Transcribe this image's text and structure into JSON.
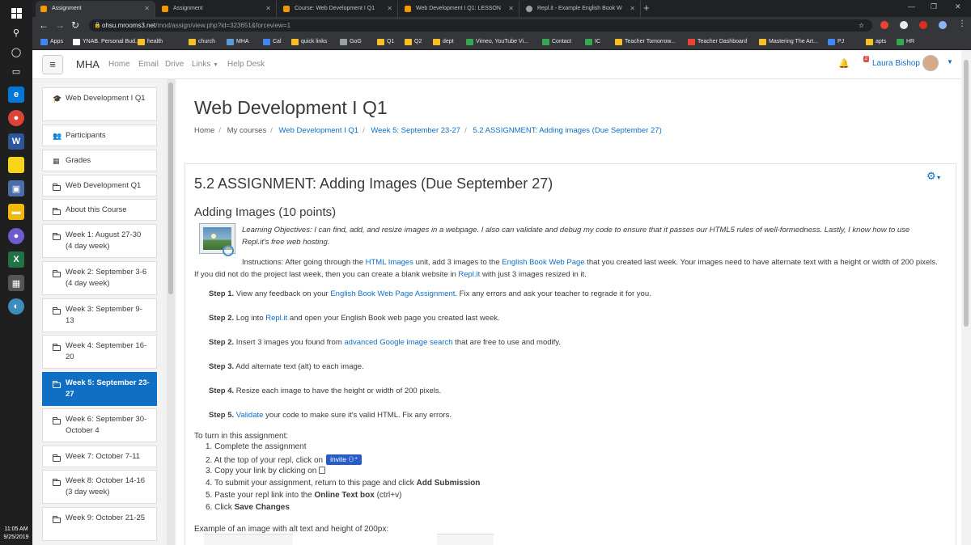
{
  "taskbar": {
    "clock_time": "11:05 AM",
    "clock_date": "9/25/2019"
  },
  "browser": {
    "tabs": [
      {
        "label": "Assignment",
        "active": true
      },
      {
        "label": "Assignment",
        "active": false
      },
      {
        "label": "Course: Web Development I Q1",
        "active": false
      },
      {
        "label": "Web Development I Q1: LESSON",
        "active": false
      },
      {
        "label": "Repl.it - Example English Book W",
        "active": false
      }
    ],
    "url_host": "ohsu.mrooms3.net",
    "url_path": "/mod/assign/view.php?id=323651&forceview=1",
    "bookmarks": [
      {
        "label": "Apps",
        "color": "#4285f4"
      },
      {
        "label": "YNAB. Personal Bud...",
        "color": "#ffffff"
      },
      {
        "label": "health",
        "color": "#f6c026"
      },
      {
        "label": "church",
        "color": "#f6c026"
      },
      {
        "label": "MHA",
        "color": "#5b9bd5"
      },
      {
        "label": "Cal",
        "color": "#4285f4"
      },
      {
        "label": "quick links",
        "color": "#f6c026"
      },
      {
        "label": "GoG",
        "color": "#9aa0a6"
      },
      {
        "label": "Q1",
        "color": "#f6c026"
      },
      {
        "label": "Q2",
        "color": "#f6c026"
      },
      {
        "label": "dept",
        "color": "#f6c026"
      },
      {
        "label": "Vimeo, YouTube Vi...",
        "color": "#34a853"
      },
      {
        "label": "Contact",
        "color": "#34a853"
      },
      {
        "label": "IC",
        "color": "#34a853"
      },
      {
        "label": "Teacher Tomorrow...",
        "color": "#f6c026"
      },
      {
        "label": "Teacher Dashboard",
        "color": "#ea4335"
      },
      {
        "label": "Mastering The Art...",
        "color": "#f6c026"
      },
      {
        "label": "PJ",
        "color": "#4285f4"
      },
      {
        "label": "apts",
        "color": "#f6c026"
      },
      {
        "label": "HR",
        "color": "#34a853"
      }
    ]
  },
  "navbar": {
    "brand": "MHA",
    "links": [
      "Home",
      "Email",
      "Drive",
      "Links",
      "Help Desk"
    ],
    "user_name": "Laura Bishop",
    "notification_count": "2"
  },
  "drawer": {
    "items": [
      {
        "label": "Web Development I Q1",
        "icon": "graduation-cap-icon",
        "active": false
      },
      {
        "label": "Participants",
        "icon": "users-icon",
        "active": false
      },
      {
        "label": "Grades",
        "icon": "table-icon",
        "active": false
      },
      {
        "label": "Web Development Q1",
        "icon": "folder-icon",
        "active": false
      },
      {
        "label": "About this Course",
        "icon": "folder-icon",
        "active": false
      },
      {
        "label": "Week 1: August 27-30 (4 day week)",
        "icon": "folder-icon",
        "active": false
      },
      {
        "label": "Week 2: September 3-6 (4 day week)",
        "icon": "folder-icon",
        "active": false
      },
      {
        "label": "Week 3: September 9-13",
        "icon": "folder-icon",
        "active": false
      },
      {
        "label": "Week 4: September 16-20",
        "icon": "folder-icon",
        "active": false
      },
      {
        "label": "Week 5: September 23-27",
        "icon": "folder-icon",
        "active": true
      },
      {
        "label": "Week 6: September 30-October 4",
        "icon": "folder-icon",
        "active": false
      },
      {
        "label": "Week 7: October 7-11",
        "icon": "folder-icon",
        "active": false
      },
      {
        "label": "Week 8: October 14-16 (3 day week)",
        "icon": "folder-icon",
        "active": false
      },
      {
        "label": "Week 9: October 21-25",
        "icon": "folder-icon",
        "active": false
      }
    ]
  },
  "main": {
    "course_title": "Web Development I Q1",
    "breadcrumb": [
      {
        "label": "Home",
        "link": false
      },
      {
        "label": "My courses",
        "link": false
      },
      {
        "label": "Web Development I Q1",
        "link": true
      },
      {
        "label": "Week 5: September 23-27",
        "link": true
      },
      {
        "label": "5.2 ASSIGNMENT: Adding images (Due September 27)",
        "link": true
      }
    ],
    "assignment_title": "5.2 ASSIGNMENT: Adding Images (Due September 27)",
    "section_title": "Adding Images (10 points)",
    "objectives": "Learning Objectives: I can find, add, and resize images in a webpage. I also can validate and debug my code to ensure that it passes our HTML5 rules of well-formedness. Lastly, I know how to use Repl.it's free web hosting.",
    "instructions": {
      "part1": "Instructions: After going through the ",
      "link1": "HTML Images",
      "part2": " unit, add 3 images to the ",
      "link2": "English Book Web Page",
      "part3": " that you created last week. Your images need to have alternate text with a height or width of 200 pixels. If you did not do the project last week, then you can create a blank website in ",
      "link3": "Repl.it",
      "part4": " with just 3 images resized in it."
    },
    "steps": [
      {
        "num": "Step 1.",
        "pre": " View any feedback on your ",
        "link": "English Book Web Page Assignment",
        "post": ". Fix any errors and ask your teacher to regrade it for you."
      },
      {
        "num": "Step 2.",
        "pre": " Log into ",
        "link": "Repl.it",
        "post": " and open your English Book web page you created last week."
      },
      {
        "num": "Step 2.",
        "pre": " Insert 3 images you found from ",
        "link": "advanced Google image search",
        "post": " that are free to use and modify."
      },
      {
        "num": "Step 3.",
        "pre": " Add alternate text (alt) to each image.",
        "link": "",
        "post": ""
      },
      {
        "num": "Step 4.",
        "pre": " Resize each image to have the height or width of 200 pixels.",
        "link": "",
        "post": ""
      },
      {
        "num": "Step 5.",
        "pre": " ",
        "link": "Validate",
        "post": " your code to make sure it's valid HTML. Fix any errors."
      }
    ],
    "turn_in_heading": "To turn in this assignment:",
    "turn_in": {
      "item1": "1. Complete the assignment",
      "item2": "2. At the top of your repl, click on",
      "invite_label": "invite",
      "item3": "3. Copy your link by clicking on",
      "item4_pre": "4. To submit your assignment, return to this page and click ",
      "item4_bold": "Add Submission",
      "item5_pre": "5. Paste your repl link into the ",
      "item5_bold": "Online Text box",
      "item5_post": " (ctrl+v)",
      "item6_pre": "6. Click ",
      "item6_bold": "Save Changes"
    },
    "example_caption": "Example of an image with alt text and height of 200px:"
  }
}
